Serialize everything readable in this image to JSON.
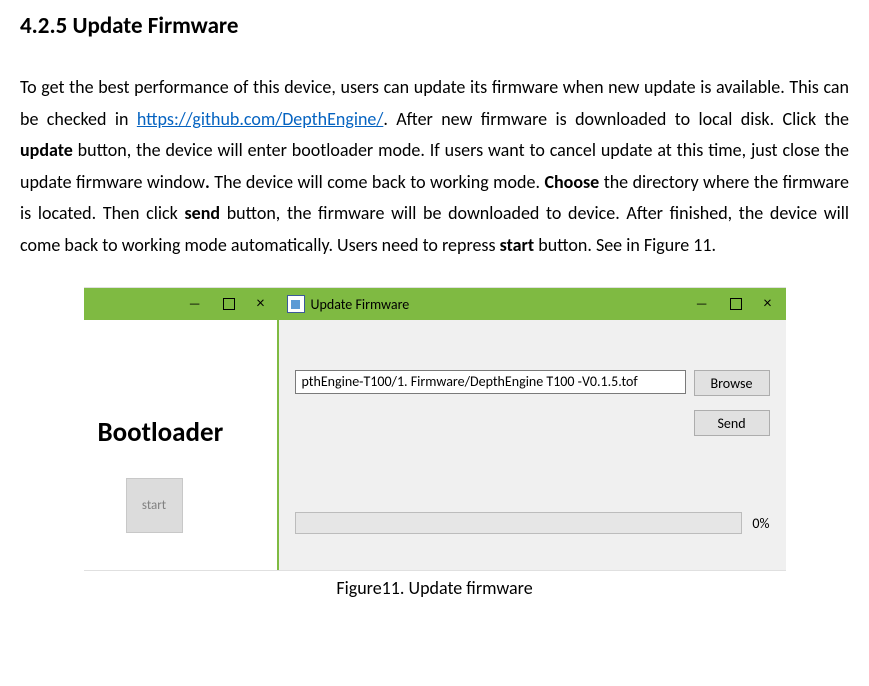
{
  "doc": {
    "heading": "4.2.5 Update Firmware",
    "p1a": "To get the best performance of this device, users can update its firmware when new update is available. This can be checked in ",
    "link_text": "https://github.com/DepthEngine/",
    "link_href": "https://github.com/DepthEngine/",
    "p1b": ". After new firmware is downloaded to local disk. Click the ",
    "b1": "update",
    "p1c": " button, the device will enter bootloader mode. If users want to cancel update at this time, just close the update firmware window",
    "b_dot": ".",
    "p1d": " The device will come back to working mode. ",
    "b2": "Choose",
    "p1e": " the directory where the firmware is located. Then click ",
    "b3": "send",
    "p1f": " button, the firmware will be downloaded to device. After finished, the device will come back to working mode automatically. Users need to repress ",
    "b4": "start",
    "p1g": " button. See in Figure 11.",
    "caption": "Figure11. Update firmware"
  },
  "ui": {
    "left": {
      "bootloader_label": "Bootloader",
      "start_label": "start"
    },
    "right": {
      "window_title": "Update Firmware",
      "path_value": "pthEngine-T100/1. Firmware/DepthEngine T100 -V0.1.5.tof",
      "browse_label": "Browse",
      "send_label": "Send",
      "progress_text": "0%"
    }
  }
}
